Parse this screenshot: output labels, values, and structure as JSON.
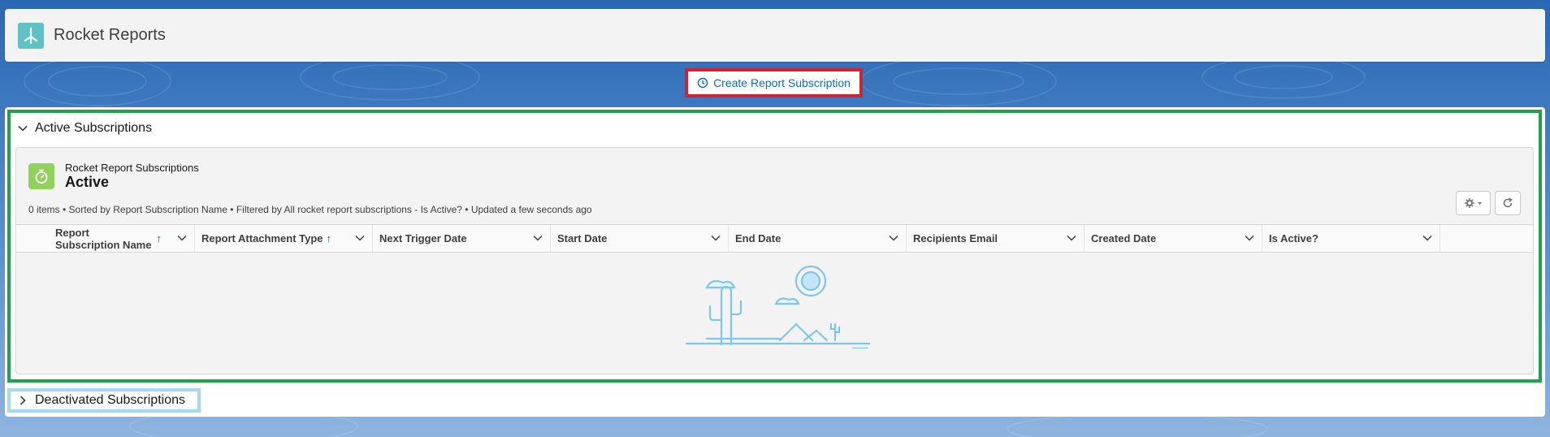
{
  "app": {
    "title": "Rocket Reports",
    "icon": "app-logo-icon"
  },
  "create_button": {
    "label": "Create Report Subscription",
    "icon": "clock-icon"
  },
  "active_section": {
    "title": "Active Subscriptions",
    "expanded": true,
    "listview": {
      "object_label": "Rocket Report Subscriptions",
      "name": "Active",
      "meta": "0 items • Sorted by Report Subscription Name • Filtered by All rocket report subscriptions - Is Active? • Updated a few seconds ago",
      "columns": [
        {
          "label": "Report Subscription Name",
          "sorted": true
        },
        {
          "label": "Report Attachment Type",
          "sorted": true
        },
        {
          "label": "Next Trigger Date",
          "sorted": false
        },
        {
          "label": "Start Date",
          "sorted": false
        },
        {
          "label": "End Date",
          "sorted": false
        },
        {
          "label": "Recipients Email",
          "sorted": false
        },
        {
          "label": "Created Date",
          "sorted": false
        },
        {
          "label": "Is Active?",
          "sorted": false
        }
      ],
      "sort_arrow": "↑",
      "empty_illustration": "desert-empty-state-icon"
    }
  },
  "deactivated_section": {
    "title": "Deactivated Subscriptions",
    "expanded": false
  },
  "colors": {
    "brand": "#0b6cc4",
    "highlight_red": "#d1222f",
    "highlight_green": "#1ea34a",
    "highlight_blue": "#a6d8ef"
  }
}
